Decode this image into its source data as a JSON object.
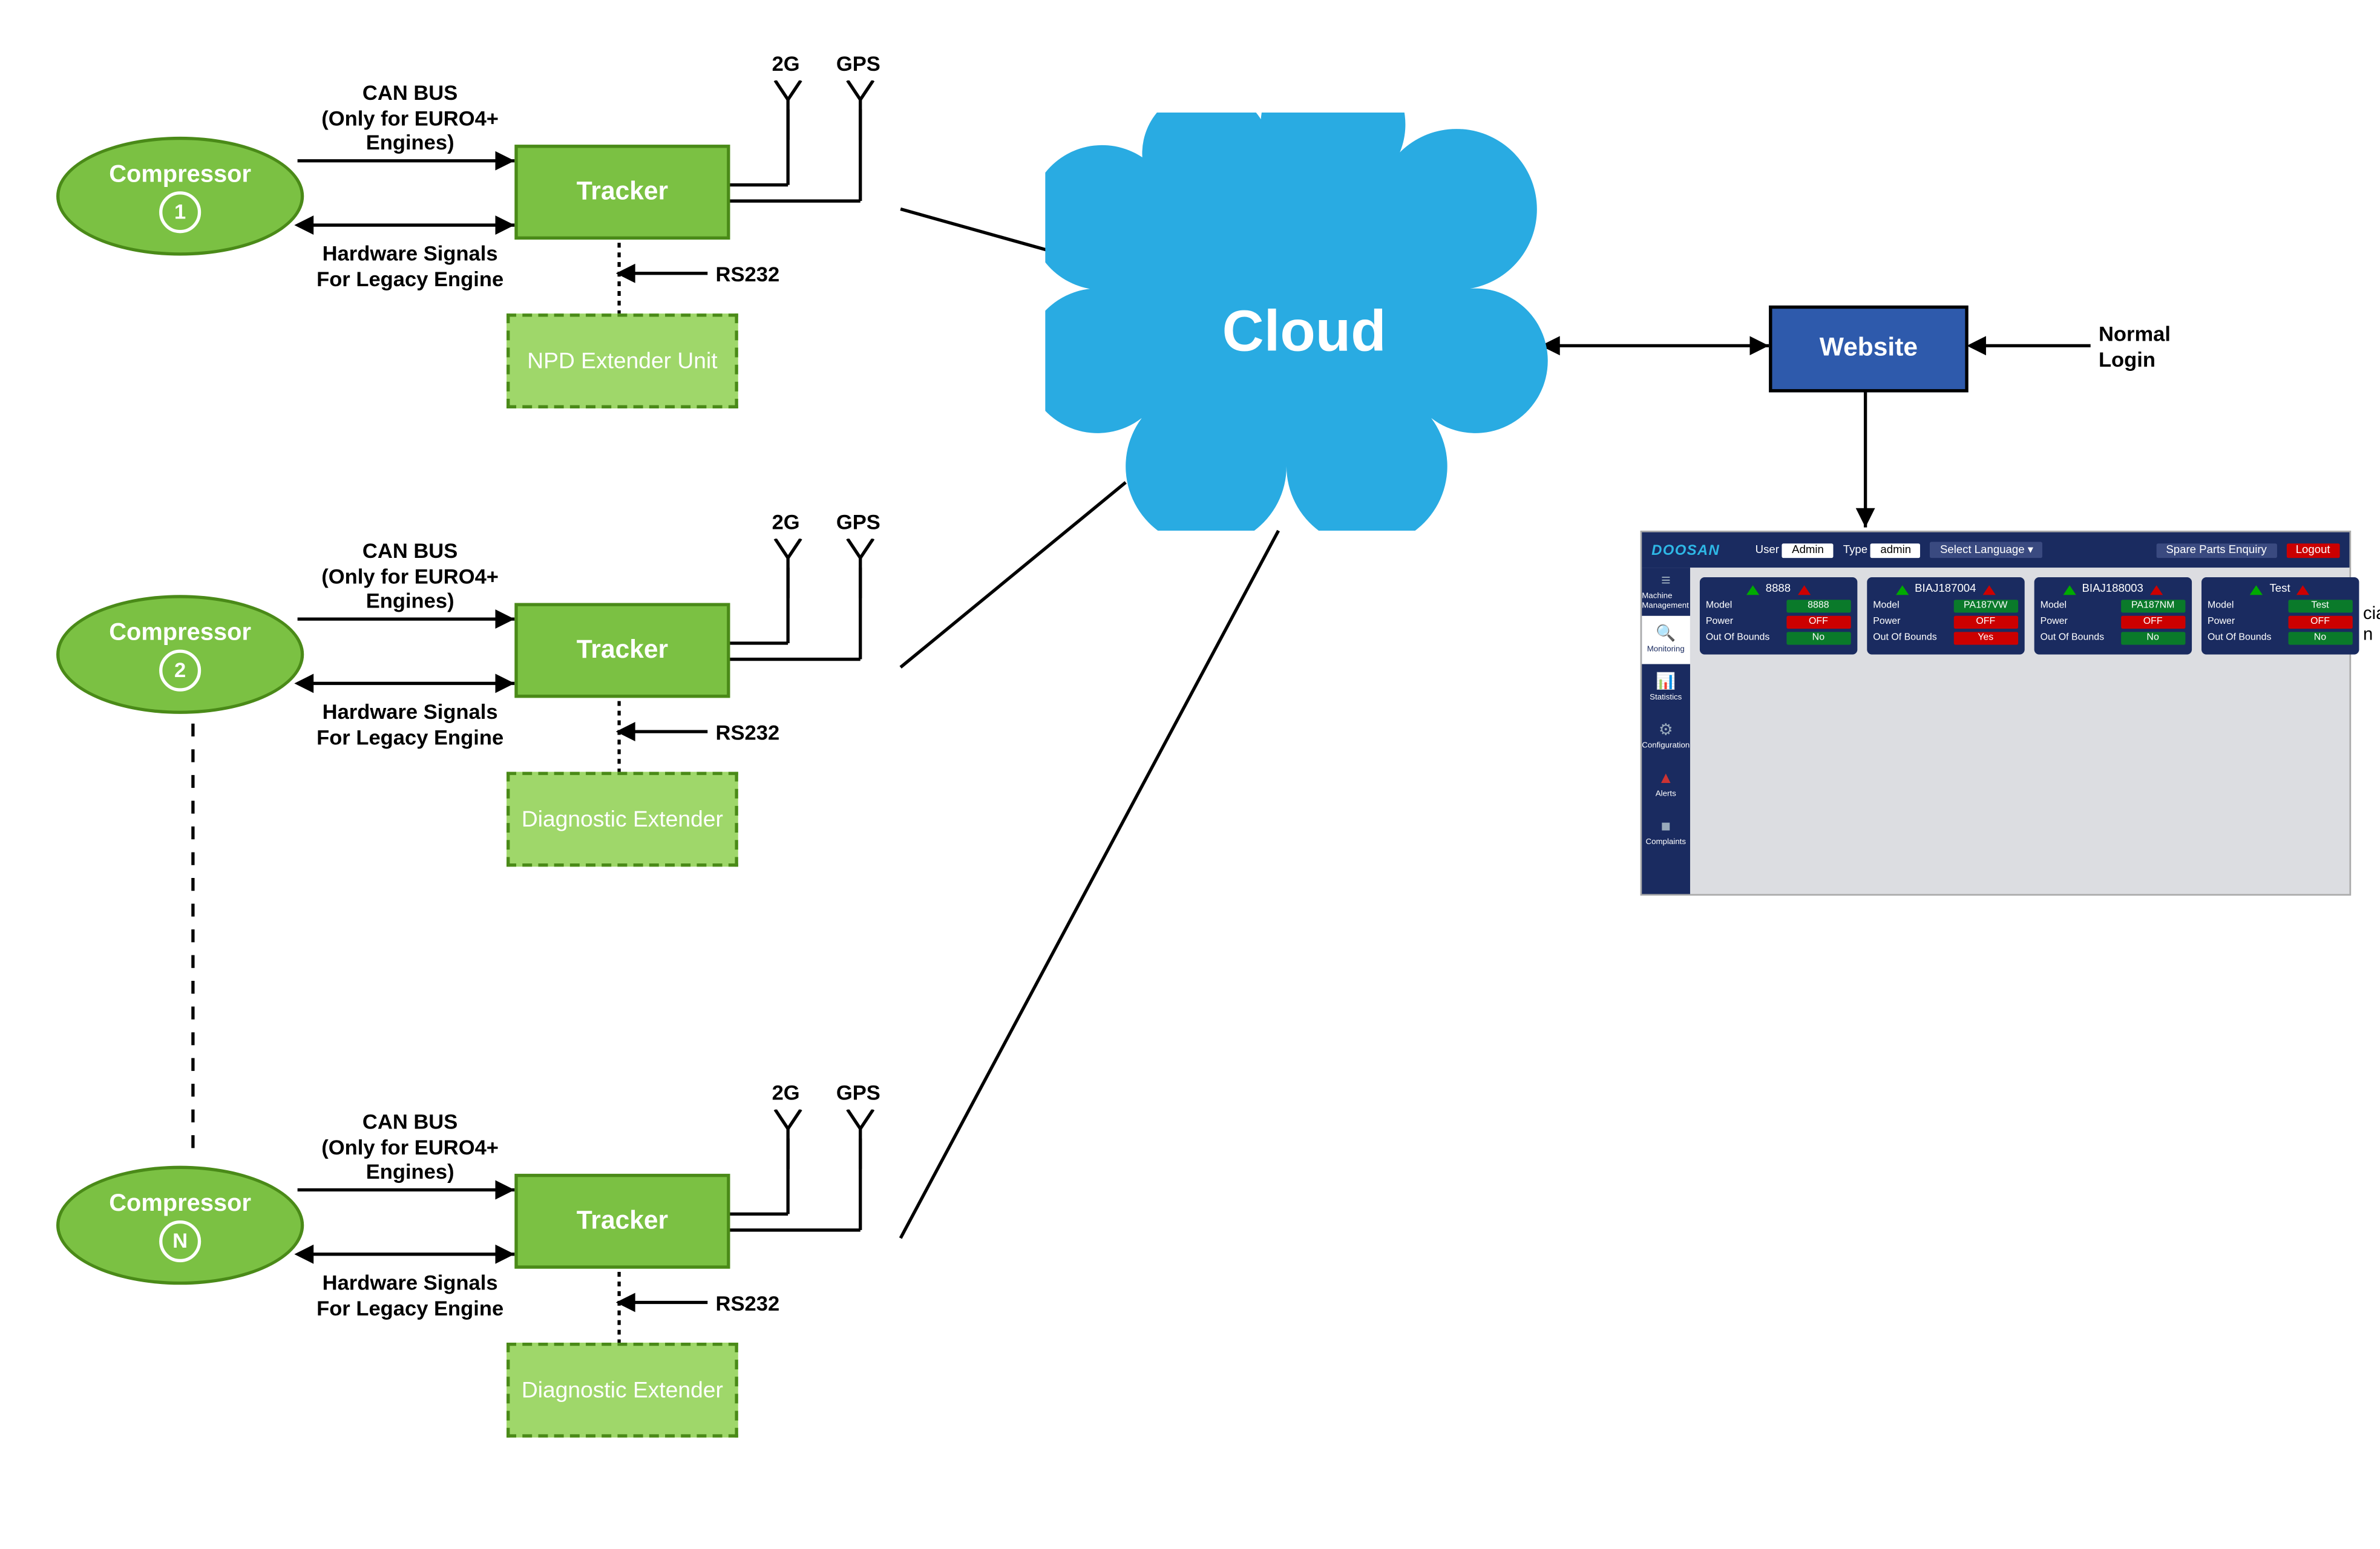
{
  "compressors": [
    {
      "label": "Compressor",
      "num": "1"
    },
    {
      "label": "Compressor",
      "num": "2"
    },
    {
      "label": "Compressor",
      "num": "N"
    }
  ],
  "tracker_label": "Tracker",
  "extenders": [
    "NPD Extender Unit",
    "Diagnostic Extender",
    "Diagnostic Extender"
  ],
  "link_canbus_l1": "CAN BUS",
  "link_canbus_l2": "(Only for EURO4+",
  "link_canbus_l3": "Engines)",
  "link_hw_l1": "Hardware Signals",
  "link_hw_l2": "For Legacy Engine",
  "link_rs232": "RS232",
  "ant_2g": "2G",
  "ant_gps": "GPS",
  "cloud": "Cloud",
  "website": "Website",
  "login_l1": "Normal",
  "login_l2": "Login",
  "dash": {
    "logo": "DOOSAN",
    "user_k": "User",
    "user_v": "Admin",
    "type_k": "Type",
    "type_v": "admin",
    "lang": "Select Language ▾",
    "enquiry": "Spare Parts Enquiry",
    "logout": "Logout",
    "side": [
      {
        "icon": "≡",
        "label": "Machine Management"
      },
      {
        "icon": "🔍",
        "label": "Monitoring"
      },
      {
        "icon": "📊",
        "label": "Statistics"
      },
      {
        "icon": "⚙",
        "label": "Configuration"
      },
      {
        "icon": "▲",
        "label": "Alerts"
      },
      {
        "icon": "■",
        "label": "Complaints"
      }
    ],
    "row_model": "Model",
    "row_power": "Power",
    "row_oob": "Out Of Bounds",
    "off": "OFF",
    "yes": "Yes",
    "no": "No",
    "cards": [
      {
        "title": "8888",
        "model": "8888",
        "oob": "No"
      },
      {
        "title": "BIAJ187004",
        "model": "PA187VW",
        "oob": "Yes"
      },
      {
        "title": "BIAJ188003",
        "model": "PA187NM",
        "oob": "No"
      },
      {
        "title": "Test",
        "model": "Test",
        "oob": "No"
      }
    ],
    "extra_l1": "cial",
    "extra_l2": "n"
  }
}
